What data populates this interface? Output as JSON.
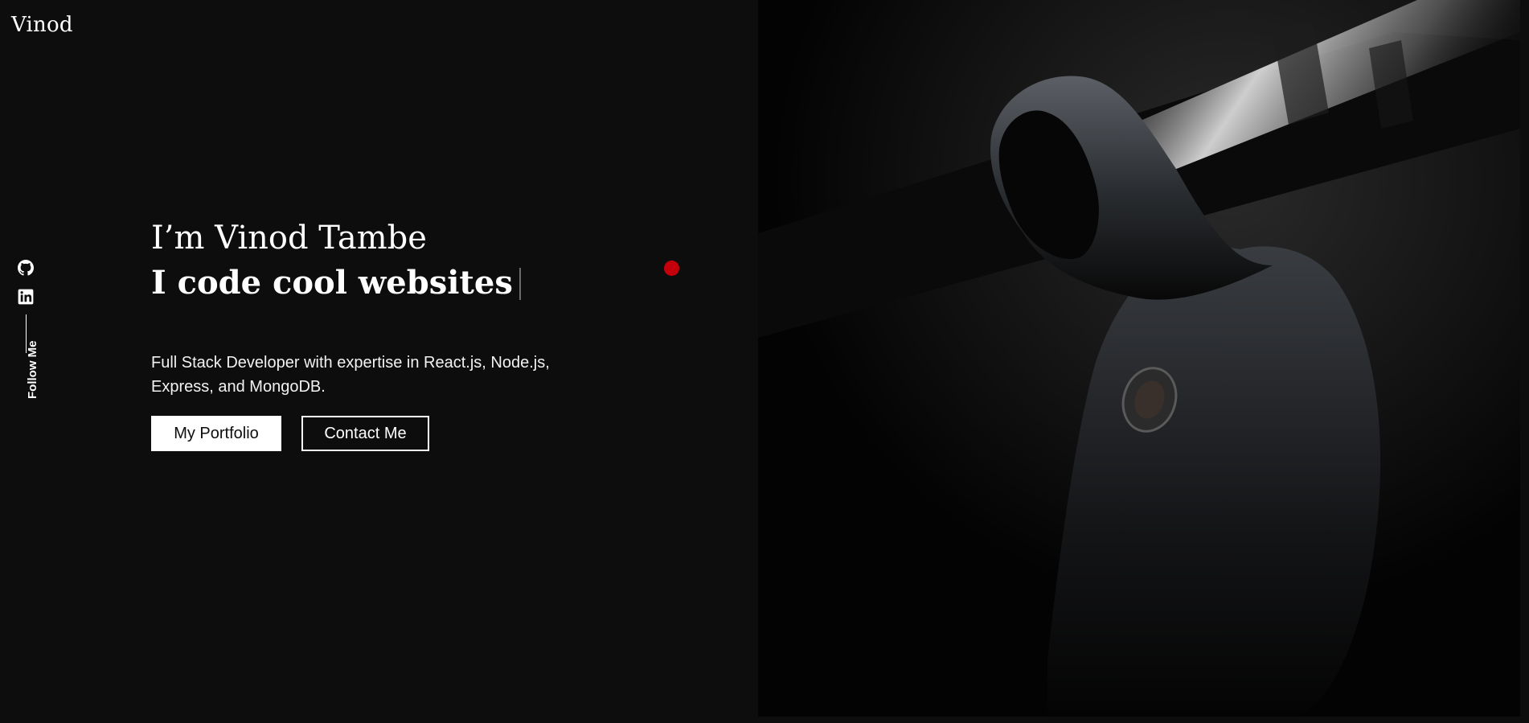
{
  "header": {
    "logo": "Vinod"
  },
  "social": {
    "follow_label": "Follow Me",
    "icons": [
      "github-icon",
      "linkedin-icon"
    ]
  },
  "hero": {
    "intro": "I’m Vinod Tambe",
    "typed_text": "I code cool websites",
    "description": "Full Stack Developer with expertise in React.js, Node.js, Express, and MongoDB.",
    "primary_button": "My Portfolio",
    "secondary_button": "Contact Me"
  },
  "colors": {
    "background": "#0d0d0d",
    "accent_dot": "#c4000a",
    "text": "#ffffff"
  }
}
